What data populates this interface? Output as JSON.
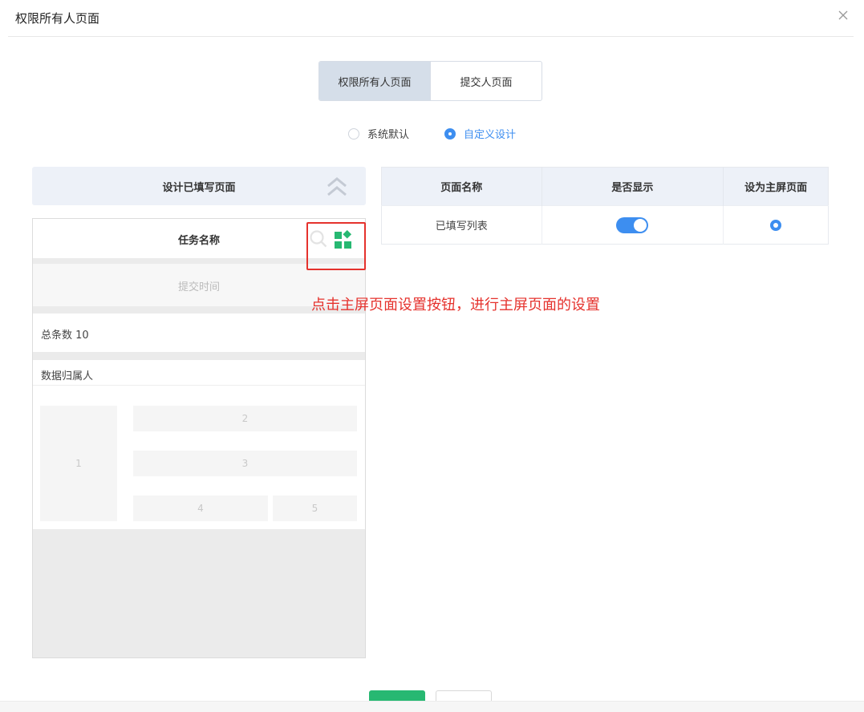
{
  "dialog": {
    "title": "权限所有人页面"
  },
  "tabs": [
    {
      "label": "权限所有人页面",
      "active": true
    },
    {
      "label": "提交人页面",
      "active": false
    }
  ],
  "mode": {
    "options": [
      {
        "label": "系统默认",
        "checked": false
      },
      {
        "label": "自定义设计",
        "checked": true
      }
    ]
  },
  "design_panel": {
    "title": "设计已填写页面"
  },
  "preview": {
    "task_name": "任务名称",
    "submit_time": "提交时间",
    "total_label": "总条数 10",
    "owner_label": "数据归属人",
    "cells": [
      "1",
      "2",
      "3",
      "4",
      "5"
    ]
  },
  "table": {
    "headers": [
      "页面名称",
      "是否显示",
      "设为主屏页面"
    ],
    "rows": [
      {
        "name": "已填写列表",
        "show": true,
        "home": true
      }
    ]
  },
  "annotation": {
    "text": "点击主屏页面设置按钮，进行主屏页面的设置"
  },
  "colors": {
    "accent": "#3d8ef0",
    "confirm_green": "#27b872",
    "annotation_red": "#e5322d"
  }
}
